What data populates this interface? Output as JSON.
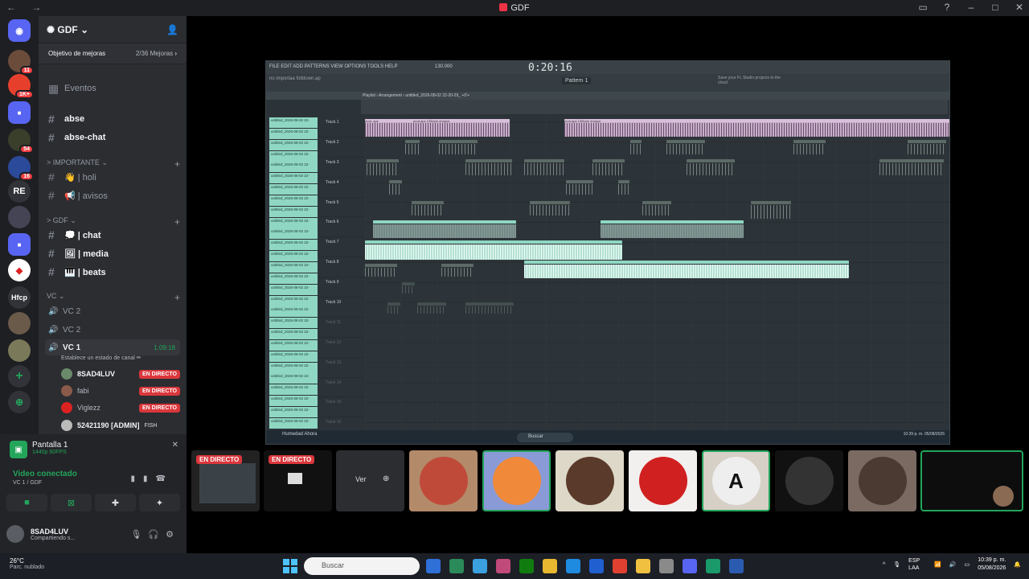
{
  "window": {
    "title": "GDF",
    "nav": "← →"
  },
  "server": {
    "name": "GDF",
    "boost_label": "Objetivo de mejoras",
    "boost_count": "2/36 Mejoras"
  },
  "channels": {
    "events": "Eventos",
    "abse": "abse",
    "abse_chat": "abse-chat",
    "cat_importante": "> IMPORTANTE",
    "holi": "👋 | holi",
    "avisos": "📢 | avisos",
    "cat_gdf": "> GDF",
    "chat": "💭 | chat",
    "media": "🖼 | media",
    "beats": "🎹 | beats",
    "cat_vc": "VC",
    "vc2a": "VC 2",
    "vc2b": "VC 2",
    "vc1": "VC 1",
    "vc1_timer": "1:09:18",
    "vc1_status": "Establece un estado de canal ✏"
  },
  "voice_users": [
    {
      "name": "8SAD4LUV",
      "live": "EN DIRECTO"
    },
    {
      "name": "fabi",
      "live": "EN DIRECTO"
    },
    {
      "name": "Viglezz",
      "live": "EN DIRECTO"
    },
    {
      "name": "52421190 [ADMIN]",
      "tag": "FISH"
    }
  ],
  "share": {
    "title": "Pantalla 1",
    "quality": "1440p 60FPS"
  },
  "voice": {
    "status": "Video conectado",
    "location": "VC 1 / GDF"
  },
  "me": {
    "name": "8SAD4LUV",
    "status": "Compartiendo s..."
  },
  "guild_badges": [
    "11",
    "1K+",
    "54",
    "16"
  ],
  "guild_labels": [
    "RE",
    "Hfcp"
  ],
  "fl": {
    "menu": "FILE EDIT ADD PATTERNS VIEW OPTIONS TOOLS HELP",
    "time": "0:20:16",
    "tempo": "130.000",
    "pattern": "Pattern 1",
    "hint": "Save your FL Studio projects to the cloud",
    "playlist_title": "Playlist › Arrangement › untitled_2026-08-02 22-20-29_ +0'+",
    "project": "no importaa folldown.ap",
    "tracks": [
      "Track 1",
      "Track 2",
      "Track 3",
      "Track 4",
      "Track 5",
      "Track 6",
      "Track 7",
      "Track 8",
      "Track 9",
      "Track 10",
      "Track 11",
      "Track 12",
      "Track 13",
      "Track 14",
      "Track 15",
      "Track 16"
    ],
    "clip_labels": {
      "c1": "prod. apz",
      "c2": "prod.apz 130bpm #mayor",
      "c3": "prod.apz 130bpm #mayor"
    },
    "picker_item": "untitled_2026-08-02 22-",
    "win_task": "Humedad Ahora",
    "win_search": "Buscar",
    "win_clock": "10:39 p. m. 05/08/2026"
  },
  "thumbs": [
    {
      "live": "EN DIRECTO"
    },
    {
      "live": "EN DIRECTO"
    },
    {
      "ver": "Ver"
    }
  ],
  "taskbar": {
    "temp": "26°C",
    "weather": "Parc. nublado",
    "search": "Buscar",
    "lang": "ESP LAA",
    "time": "10:39 p. m.",
    "date": "05/08/2026"
  }
}
